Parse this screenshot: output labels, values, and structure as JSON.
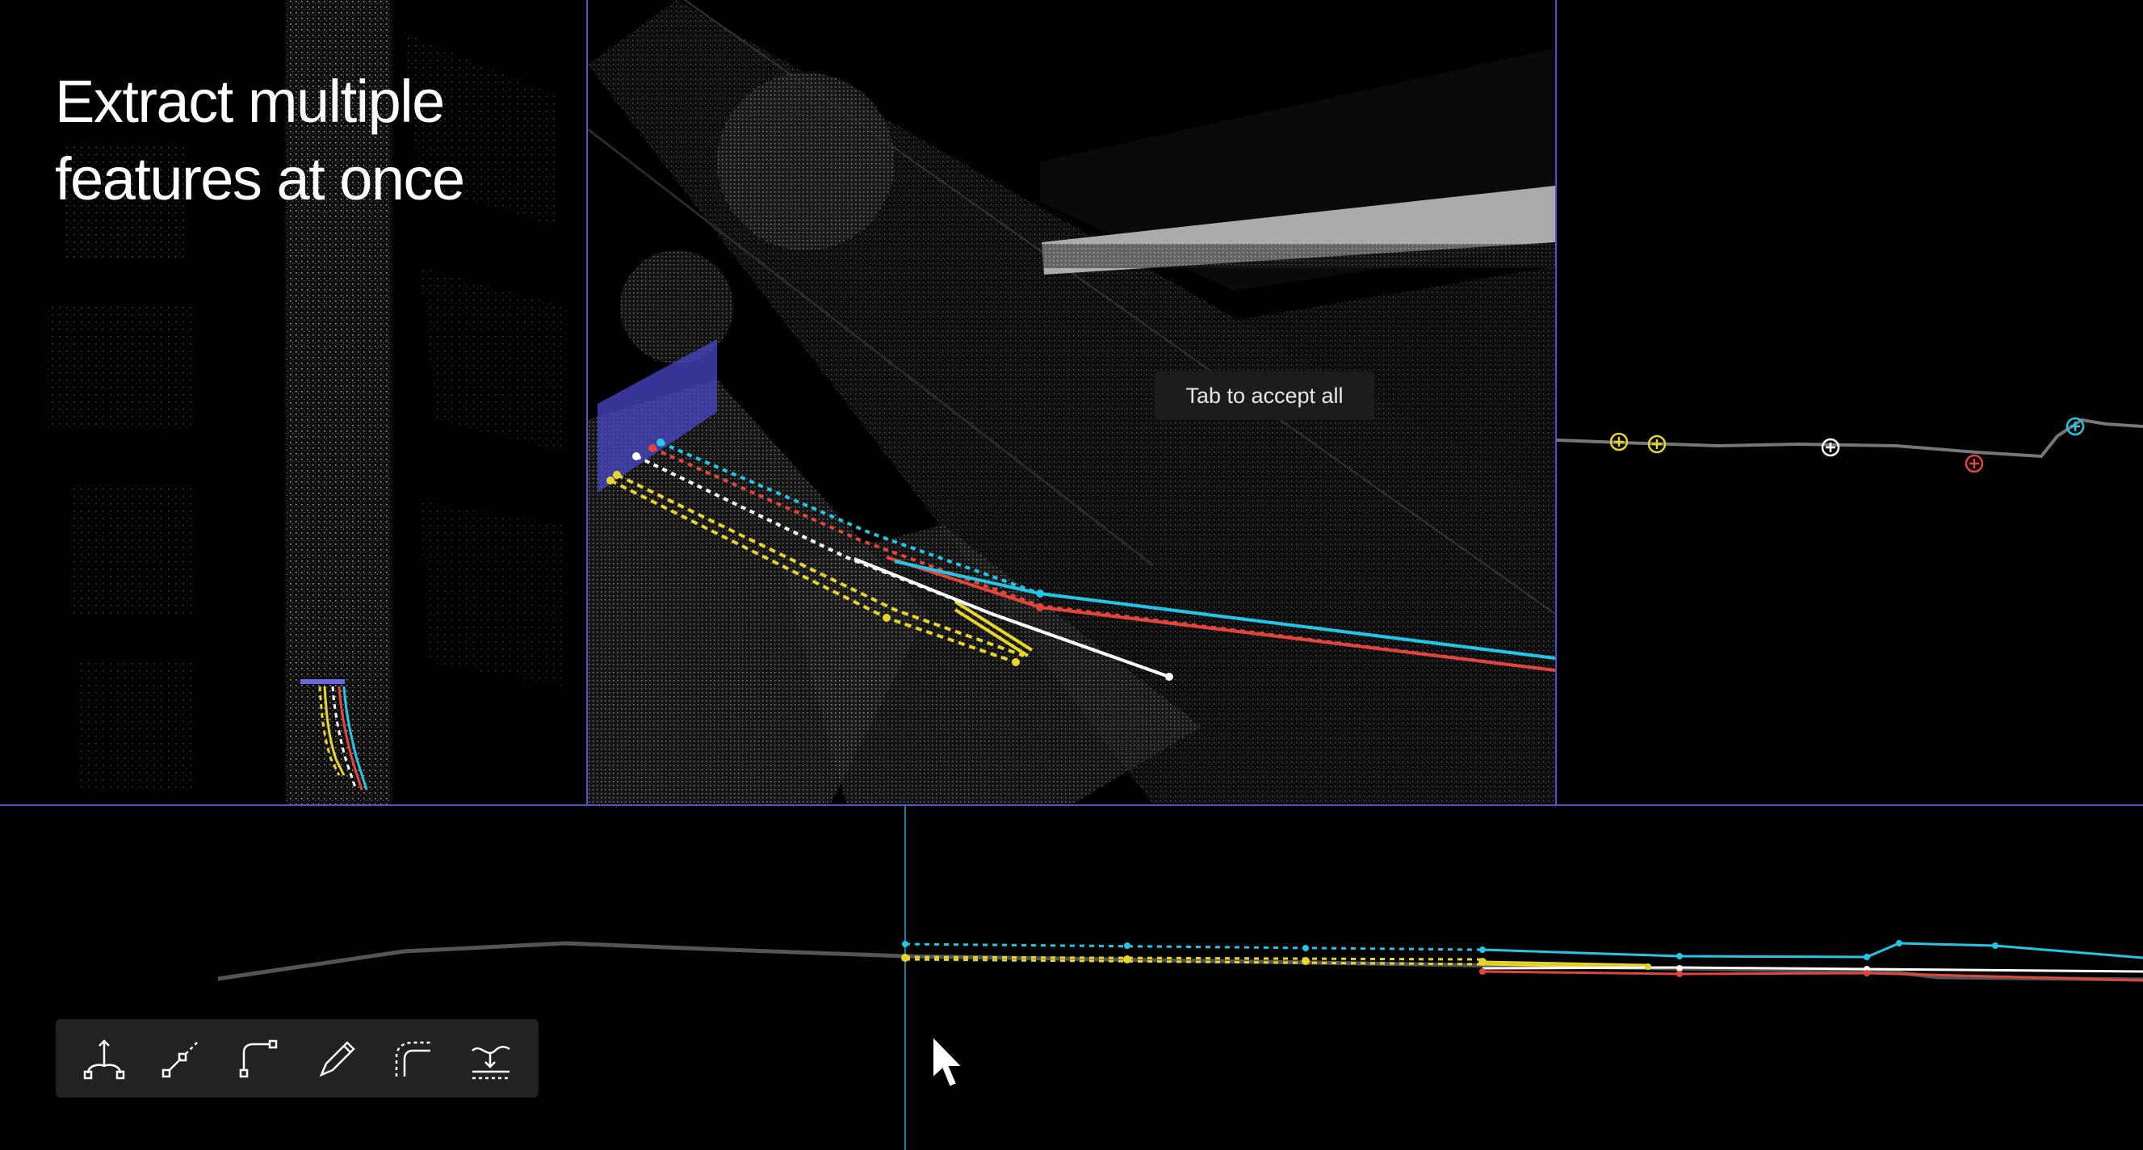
{
  "headline": {
    "line1": "Extract multiple",
    "line2": "features at once"
  },
  "tooltip": {
    "text": "Tab to accept all"
  },
  "colors": {
    "divider": "#4f52c9",
    "yellow": "#e8d52a",
    "cyan": "#22c7e6",
    "red": "#e2453c",
    "white": "#ffffff",
    "selection_box": "#4a48c9"
  },
  "toolbar": {
    "tools": [
      {
        "icon": "branch-tool-icon"
      },
      {
        "icon": "dashed-segment-tool-icon"
      },
      {
        "icon": "corner-segment-tool-icon"
      },
      {
        "icon": "pen-tool-icon"
      },
      {
        "icon": "curve-offset-tool-icon"
      },
      {
        "icon": "drape-to-surface-tool-icon"
      }
    ]
  }
}
